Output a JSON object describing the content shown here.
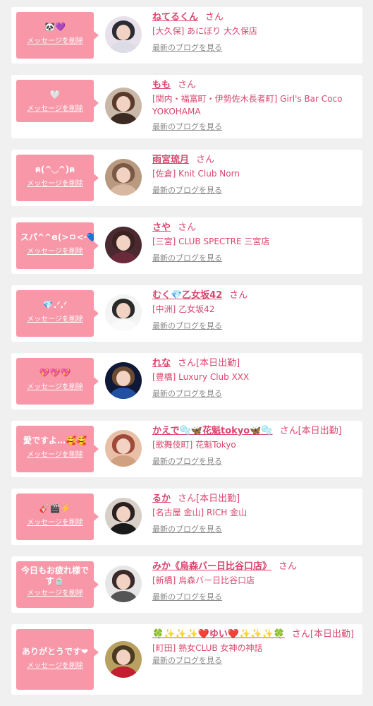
{
  "colors": {
    "accent": "#d9466f",
    "bubble": "#f797a8",
    "muted": "#888888",
    "background": "#f0f0f0"
  },
  "common": {
    "delete_label": "メッセージを削除",
    "blog_label": "最新のブログを見る"
  },
  "cards": [
    {
      "message": "🐼💜",
      "name": "ねてるくん",
      "suffix": "さん",
      "shop": "[大久保] あにぼり 大久保店",
      "avatar_hair": "#2b2b33",
      "avatar_body": "#dcdce6",
      "avatar_bg": "#e8e0ea"
    },
    {
      "message": "🤍",
      "name": "もも",
      "suffix": "さん",
      "shop": "[関内・福富町・伊勢佐木長者町] Girl's Bar Coco YOKOHAMA",
      "avatar_hair": "#5a3a2a",
      "avatar_body": "#3b2a22",
      "avatar_bg": "#c9b7a8"
    },
    {
      "message": "ฅ(^◡︎^)ฅ",
      "name": "雨宮琉月",
      "suffix": "さん",
      "shop": "[佐倉] Knit Club Norn",
      "avatar_hair": "#7a5a44",
      "avatar_body": "#d8b8a0",
      "avatar_bg": "#b89a80"
    },
    {
      "message": "スパ^^ɞ(>ㅁ<·💙",
      "name": "さや",
      "suffix": "さん",
      "shop": "[三宮] CLUB SPECTRE 三宮店",
      "avatar_hair": "#3a2220",
      "avatar_body": "#6b2a3a",
      "avatar_bg": "#4a2a30"
    },
    {
      "message": "💎.ᐟ.ᐟ",
      "name": "むく💎乙女坂42",
      "suffix": "さん",
      "shop": "[中洲] 乙女坂42",
      "avatar_hair": "#2a2a2a",
      "avatar_body": "#fafafa",
      "avatar_bg": "#f4f4f4"
    },
    {
      "message": "💖💖💖",
      "name": "れな",
      "suffix": "さん[本日出勤]",
      "shop": "[豊橋] Luxury Club XXX",
      "avatar_hair": "#6a4a30",
      "avatar_body": "#2050a0",
      "avatar_bg": "#101838"
    },
    {
      "message": "愛ですよ…🥰🥰",
      "name": "かえで🫧🦋花魁tokyo🦋🫧",
      "suffix": "さん[本日出勤]",
      "shop": "[歌舞伎町] 花魁Tokyo",
      "avatar_hair": "#a04a3a",
      "avatar_body": "#d0a080",
      "avatar_bg": "#e8c0a8"
    },
    {
      "message": "🎸🎬⚡️",
      "name": "るか",
      "suffix": "さん[本日出勤]",
      "shop": "[名古屋 金山] RICH 金山",
      "avatar_hair": "#2a2020",
      "avatar_body": "#1a1a1a",
      "avatar_bg": "#d8d0c8"
    },
    {
      "message": "今日もお疲れ様です🍵",
      "name": "みか《烏森バー日比谷口店》",
      "suffix": "さん",
      "shop": "[新橋] 烏森バー日比谷口店",
      "avatar_hair": "#3a2a2a",
      "avatar_body": "#555555",
      "avatar_bg": "#e6e6e6"
    },
    {
      "message": "ありがとうです❤︎",
      "name": "🍀✨✨✨❤️ゆい❤️✨✨✨🍀",
      "suffix": "さん[本日出勤]",
      "shop": "[町田] 熟女CLUB 女神の神話",
      "avatar_hair": "#4a3a20",
      "avatar_body": "#c02030",
      "avatar_bg": "#b8a060"
    }
  ]
}
